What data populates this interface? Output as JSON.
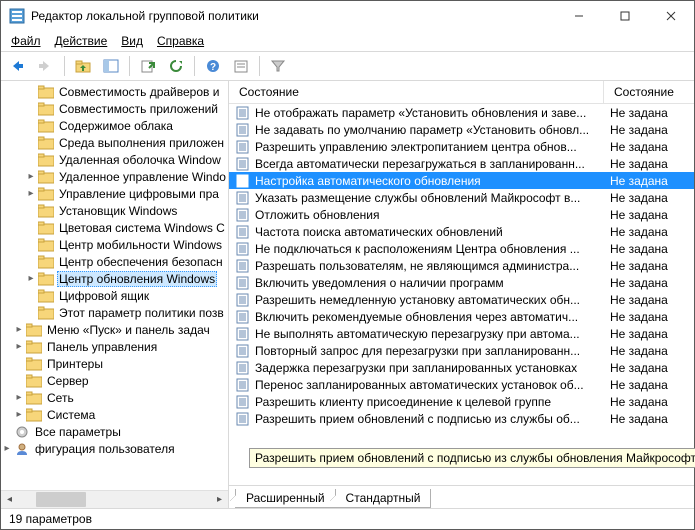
{
  "window": {
    "title": "Редактор локальной групповой политики"
  },
  "menu": {
    "file": "Файл",
    "action": "Действие",
    "view": "Вид",
    "help": "Справка"
  },
  "tree": {
    "items": [
      {
        "label": "Совместимость драйверов и",
        "indent": 1
      },
      {
        "label": "Совместимость приложений",
        "indent": 1
      },
      {
        "label": "Содержимое облака",
        "indent": 1
      },
      {
        "label": "Среда выполнения приложен",
        "indent": 1
      },
      {
        "label": "Удаленная оболочка Window",
        "indent": 1
      },
      {
        "label": "Удаленное управление Windo",
        "indent": 1,
        "twist": true
      },
      {
        "label": "Управление цифровыми пра",
        "indent": 1,
        "twist": true
      },
      {
        "label": "Установщик Windows",
        "indent": 1
      },
      {
        "label": "Цветовая система Windows C",
        "indent": 1
      },
      {
        "label": "Центр мобильности Windows",
        "indent": 1
      },
      {
        "label": "Центр обеспечения безопасн",
        "indent": 1
      },
      {
        "label": "Центр обновления Windows",
        "indent": 1,
        "selected": true,
        "twist": true
      },
      {
        "label": "Цифровой ящик",
        "indent": 1
      },
      {
        "label": "Этот параметр политики позв",
        "indent": 1
      },
      {
        "label": "Меню «Пуск» и панель задач",
        "indent": 0,
        "twist": true
      },
      {
        "label": "Панель управления",
        "indent": 0,
        "twist": true
      },
      {
        "label": "Принтеры",
        "indent": 0
      },
      {
        "label": "Сервер",
        "indent": 0
      },
      {
        "label": "Сеть",
        "indent": 0,
        "twist": true
      },
      {
        "label": "Система",
        "indent": 0,
        "twist": true
      },
      {
        "label": "Все параметры",
        "indent": -1,
        "special": "all"
      },
      {
        "label": "фигурация пользователя",
        "indent": -1,
        "special": "user",
        "twist": true
      }
    ]
  },
  "list": {
    "header_col1": "Состояние",
    "header_col2": "Состояние",
    "rows": [
      {
        "text": "Не отображать параметр «Установить обновления и заве...",
        "status": "Не задана"
      },
      {
        "text": "Не задавать по умолчанию параметр «Установить обновл...",
        "status": "Не задана"
      },
      {
        "text": "Разрешить управлению электропитанием центра обнов...",
        "status": "Не задана"
      },
      {
        "text": "Всегда автоматически перезагружаться в запланированн...",
        "status": "Не задана"
      },
      {
        "text": "Настройка автоматического обновления",
        "status": "Не задана",
        "selected": true
      },
      {
        "text": "Указать размещение службы обновлений Майкрософт в...",
        "status": "Не задана"
      },
      {
        "text": "Отложить обновления",
        "status": "Не задана"
      },
      {
        "text": "Частота поиска автоматических обновлений",
        "status": "Не задана"
      },
      {
        "text": "Не подключаться к расположениям Центра обновления ...",
        "status": "Не задана"
      },
      {
        "text": "Разрешать пользователям, не являющимся администра...",
        "status": "Не задана"
      },
      {
        "text": "Включить уведомления о наличии программ",
        "status": "Не задана"
      },
      {
        "text": "Разрешить немедленную установку автоматических обн...",
        "status": "Не задана"
      },
      {
        "text": "Включить рекомендуемые обновления через автоматич...",
        "status": "Не задана"
      },
      {
        "text": "Не выполнять автоматическую перезагрузку при автома...",
        "status": "Не задана"
      },
      {
        "text": "Повторный запрос для перезагрузки при запланированн...",
        "status": "Не задана"
      },
      {
        "text": "Задержка перезагрузки при запланированных установках",
        "status": "Не задана"
      },
      {
        "text": "Перенос запланированных автоматических установок об...",
        "status": "Не задана"
      },
      {
        "text": "Разрешить клиенту присоединение к целевой группе",
        "status": "Не задана"
      },
      {
        "text": "Разрешить прием обновлений с подписью из службы об...",
        "status": "Не задана"
      }
    ],
    "tooltip": "Разрешить прием обновлений с подписью из службы обновления Майкрософт в"
  },
  "tabs": {
    "extended": "Расширенный",
    "standard": "Стандартный"
  },
  "status": {
    "text": "19 параметров"
  }
}
